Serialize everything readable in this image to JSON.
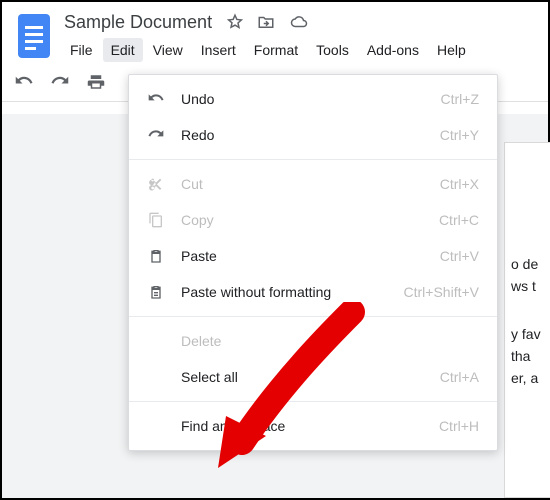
{
  "header": {
    "title": "Sample Document",
    "menus": [
      "File",
      "Edit",
      "View",
      "Insert",
      "Format",
      "Tools",
      "Add-ons",
      "Help"
    ],
    "active_menu_index": 1
  },
  "edit_menu": {
    "undo": {
      "label": "Undo",
      "shortcut": "Ctrl+Z"
    },
    "redo": {
      "label": "Redo",
      "shortcut": "Ctrl+Y"
    },
    "cut": {
      "label": "Cut",
      "shortcut": "Ctrl+X"
    },
    "copy": {
      "label": "Copy",
      "shortcut": "Ctrl+C"
    },
    "paste": {
      "label": "Paste",
      "shortcut": "Ctrl+V"
    },
    "paste_plain": {
      "label": "Paste without formatting",
      "shortcut": "Ctrl+Shift+V"
    },
    "delete": {
      "label": "Delete",
      "shortcut": ""
    },
    "select_all": {
      "label": "Select all",
      "shortcut": "Ctrl+A"
    },
    "find_replace": {
      "label": "Find and replace",
      "shortcut": "Ctrl+H"
    }
  },
  "page_text": {
    "l1": "o de",
    "l2": "ws t",
    "l3": "y fav",
    "l4": " tha",
    "l5": "er, a"
  }
}
